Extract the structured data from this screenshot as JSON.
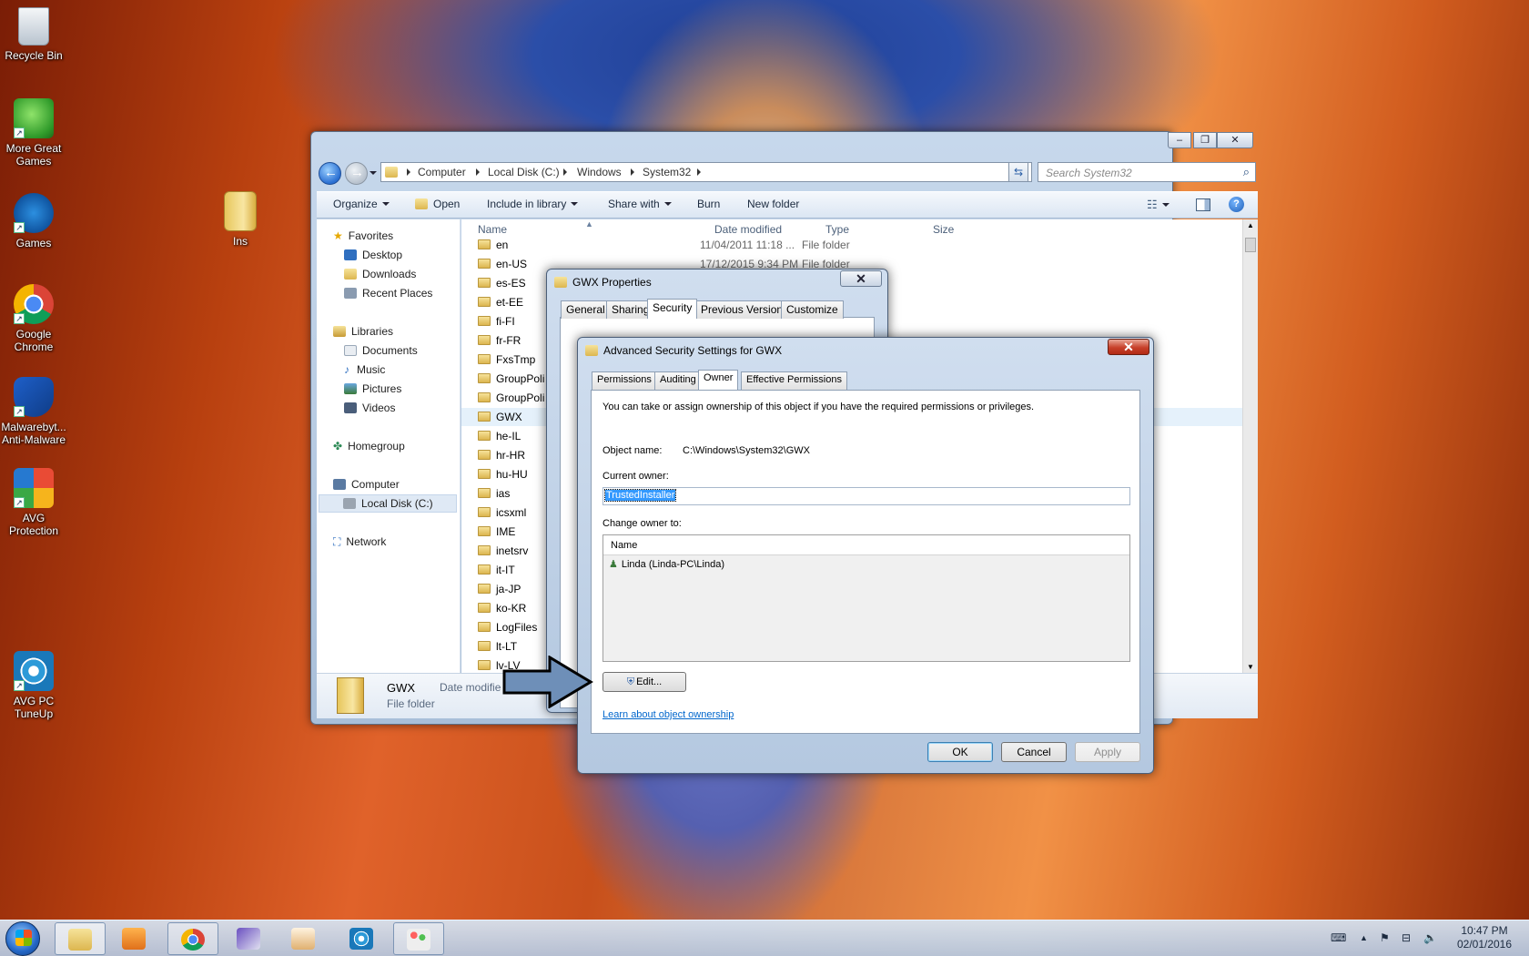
{
  "desktop": {
    "icons": [
      {
        "label": "Recycle Bin"
      },
      {
        "label": "More Great Games"
      },
      {
        "label": "Games"
      },
      {
        "label": "Google Chrome"
      },
      {
        "label": "Malwarebyt... Anti-Malware"
      },
      {
        "label": "AVG Protection"
      },
      {
        "label": "AVG PC TuneUp"
      },
      {
        "label": "Ins"
      }
    ]
  },
  "explorer": {
    "breadcrumb": [
      "Computer",
      "Local Disk (C:)",
      "Windows",
      "System32"
    ],
    "search_placeholder": "Search System32",
    "toolbar": {
      "organize": "Organize",
      "open": "Open",
      "include_in_library": "Include in library",
      "share_with": "Share with",
      "burn": "Burn",
      "new_folder": "New folder"
    },
    "nav": {
      "favorites": "Favorites",
      "desktop": "Desktop",
      "downloads": "Downloads",
      "recent_places": "Recent Places",
      "libraries": "Libraries",
      "documents": "Documents",
      "music": "Music",
      "pictures": "Pictures",
      "videos": "Videos",
      "homegroup": "Homegroup",
      "computer": "Computer",
      "local_disk": "Local Disk (C:)",
      "network": "Network"
    },
    "columns": {
      "name": "Name",
      "date_modified": "Date modified",
      "type": "Type",
      "size": "Size"
    },
    "rows": [
      {
        "name": "en",
        "date": "11/04/2011 11:18 ...",
        "type": "File folder"
      },
      {
        "name": "en-US",
        "date": "17/12/2015 9:34 PM",
        "type": "File folder"
      },
      {
        "name": "es-ES",
        "date": "",
        "type": ""
      },
      {
        "name": "et-EE",
        "date": "",
        "type": ""
      },
      {
        "name": "fi-FI",
        "date": "",
        "type": ""
      },
      {
        "name": "fr-FR",
        "date": "",
        "type": ""
      },
      {
        "name": "FxsTmp",
        "date": "",
        "type": ""
      },
      {
        "name": "GroupPoli",
        "date": "",
        "type": ""
      },
      {
        "name": "GroupPoli",
        "date": "",
        "type": ""
      },
      {
        "name": "GWX",
        "date": "",
        "type": ""
      },
      {
        "name": "he-IL",
        "date": "",
        "type": ""
      },
      {
        "name": "hr-HR",
        "date": "",
        "type": ""
      },
      {
        "name": "hu-HU",
        "date": "",
        "type": ""
      },
      {
        "name": "ias",
        "date": "",
        "type": ""
      },
      {
        "name": "icsxml",
        "date": "",
        "type": ""
      },
      {
        "name": "IME",
        "date": "",
        "type": ""
      },
      {
        "name": "inetsrv",
        "date": "",
        "type": ""
      },
      {
        "name": "it-IT",
        "date": "",
        "type": ""
      },
      {
        "name": "ja-JP",
        "date": "",
        "type": ""
      },
      {
        "name": "ko-KR",
        "date": "",
        "type": ""
      },
      {
        "name": "LogFiles",
        "date": "",
        "type": ""
      },
      {
        "name": "lt-LT",
        "date": "",
        "type": ""
      },
      {
        "name": "lv-LV",
        "date": "",
        "type": ""
      }
    ],
    "details": {
      "name": "GWX",
      "type": "File folder",
      "date_label": "Date modifie"
    }
  },
  "properties": {
    "title": "GWX Properties",
    "tabs": [
      "General",
      "Sharing",
      "Security",
      "Previous Versions",
      "Customize"
    ]
  },
  "advanced": {
    "title": "Advanced Security Settings for GWX",
    "tabs": [
      "Permissions",
      "Auditing",
      "Owner",
      "Effective Permissions"
    ],
    "info": "You can take or assign ownership of this object if you have the required permissions or privileges.",
    "object_name_label": "Object name:",
    "object_name_value": "C:\\Windows\\System32\\GWX",
    "current_owner_label": "Current owner:",
    "current_owner_value": "TrustedInstaller",
    "change_owner_label": "Change owner to:",
    "list_header": "Name",
    "list_items": [
      "Linda (Linda-PC\\Linda)"
    ],
    "edit_button": "Edit...",
    "learn_link": "Learn about object ownership",
    "ok": "OK",
    "cancel": "Cancel",
    "apply": "Apply"
  },
  "taskbar": {
    "time": "10:47 PM",
    "date": "02/01/2016"
  }
}
